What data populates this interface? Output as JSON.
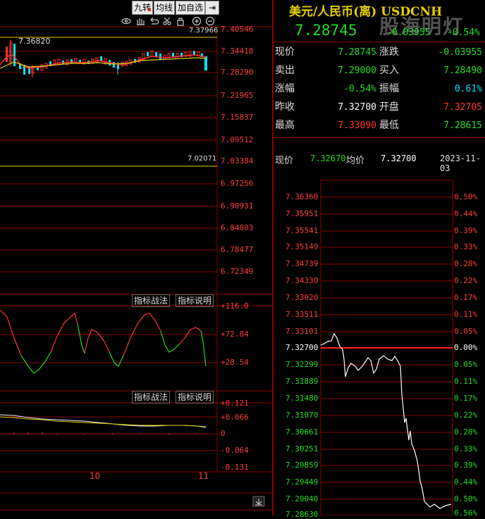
{
  "toolbar": {
    "buttons": [
      "九转",
      "均线",
      "加自选"
    ],
    "tool_icons": [
      "eye-icon",
      "hand-icon",
      "undo-icon",
      "scissors-icon",
      "lock-icon",
      "zoom-in-icon",
      "zoom-out-icon",
      "exit-icon"
    ]
  },
  "kline": {
    "price_axis": [
      "7.40546",
      "7.34418",
      "7.28290",
      "7.21965",
      "7.15837",
      "7.09512",
      "7.03384",
      "6.97256",
      "6.90931",
      "6.84803",
      "6.78477",
      "6.72349"
    ],
    "high_marker": "7.37966",
    "top_marker": "7.36820",
    "low_marker": "7.02071"
  },
  "indicator1": {
    "btn_battle": "指标战法",
    "btn_explain": "指标说明",
    "axis": [
      "+116.0",
      "+72.84",
      "+28.54"
    ]
  },
  "indicator2": {
    "btn_battle": "指标战法",
    "btn_explain": "指标说明",
    "axis": [
      "+0.121",
      "+0.066",
      "0",
      "-0.064",
      "-0.131"
    ]
  },
  "date_axis": [
    "10",
    "11"
  ],
  "header": {
    "title": "美元/人民币(离) USDCNH",
    "price": "7.28745",
    "change": "-0.03955",
    "change_pct": "-0.54%",
    "watermark": "股海明灯"
  },
  "quote": {
    "rows": [
      {
        "l1": "现价",
        "v1": "7.28745",
        "c1": "g",
        "l2": "涨跌",
        "v2": "-0.03955",
        "c2": "g"
      },
      {
        "l1": "卖出",
        "v1": "7.29000",
        "c1": "g",
        "l2": "买入",
        "v2": "7.28490",
        "c2": "g"
      },
      {
        "l1": "涨幅",
        "v1": "-0.54%",
        "c1": "g",
        "l2": "振幅",
        "v2": "0.61%",
        "c2": "c"
      },
      {
        "l1": "昨收",
        "v1": "7.32700",
        "c1": "w",
        "l2": "开盘",
        "v2": "7.32705",
        "c2": "r"
      },
      {
        "l1": "最高",
        "v1": "7.33090",
        "c1": "r",
        "l2": "最低",
        "v2": "7.28615",
        "c2": "g"
      }
    ]
  },
  "intraday": {
    "label_now": "现价",
    "now": "7.32670",
    "label_avg": "均价",
    "avg": "7.32700",
    "date": "2023-11-03",
    "left_axis": [
      "7.36360",
      "7.35951",
      "7.35541",
      "7.35149",
      "7.34739",
      "7.34330",
      "7.33920",
      "7.33511",
      "7.33101",
      "7.32700",
      "7.32299",
      "7.31889",
      "7.31480",
      "7.31070",
      "7.30661",
      "7.30251",
      "7.29859",
      "7.29449",
      "7.29040",
      "7.28630"
    ],
    "right_axis": [
      "0.50%",
      "0.44%",
      "0.39%",
      "0.33%",
      "0.28%",
      "0.22%",
      "0.17%",
      "0.11%",
      "0.05%",
      "0.00%",
      "0.05%",
      "0.11%",
      "0.17%",
      "0.22%",
      "0.28%",
      "0.33%",
      "0.39%",
      "0.44%",
      "0.50%",
      "0.56%"
    ]
  },
  "colors": {
    "up": "#ff3333",
    "down": "#22dd22",
    "grid": "#8b0000",
    "neutral": "#ffffff",
    "title": "#e8d000"
  }
}
